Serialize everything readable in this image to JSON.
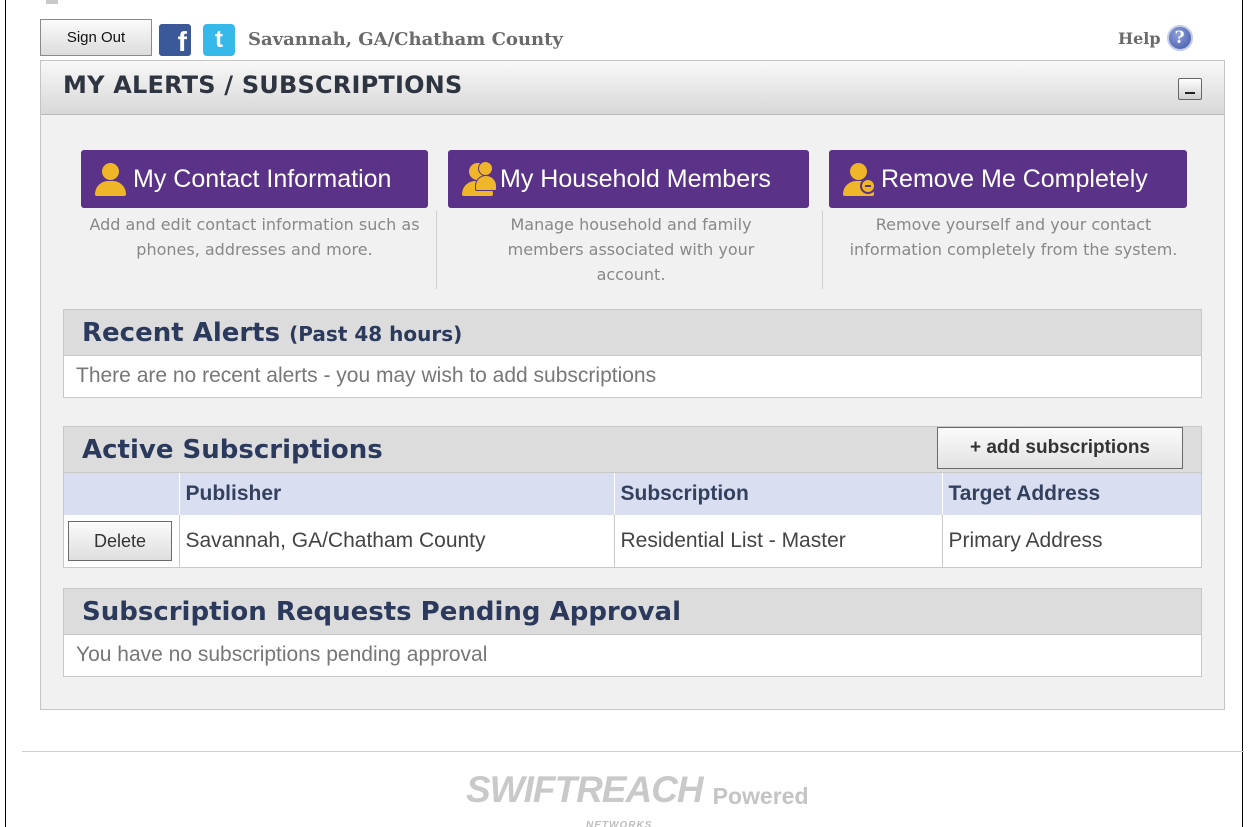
{
  "topbar": {
    "signout_label": "Sign Out",
    "facebook_glyph": "f",
    "twitter_glyph": "t",
    "agency": "Savannah, GA/Chatham County",
    "help_label": "Help",
    "help_glyph": "?"
  },
  "panel": {
    "title": "MY ALERTS / SUBSCRIPTIONS"
  },
  "actions": [
    {
      "label": "My Contact Information",
      "icon": "person-icon",
      "description": "Add and edit contact information such as phones, addresses and more."
    },
    {
      "label": "My Household Members",
      "icon": "household-icon",
      "description": "Manage household and family members associated with your account."
    },
    {
      "label": "Remove Me Completely",
      "icon": "remove-person-icon",
      "description": "Remove yourself and your contact information completely from the system."
    }
  ],
  "recent_alerts": {
    "title": "Recent Alerts",
    "subtitle": "(Past 48 hours)",
    "message": "There are no recent alerts - you may wish to add subscriptions"
  },
  "active_subscriptions": {
    "title": "Active Subscriptions",
    "add_label": "+ add subscriptions",
    "columns": [
      "",
      "Publisher",
      "Subscription",
      "Target Address"
    ],
    "rows": [
      {
        "action": "Delete",
        "publisher": "Savannah, GA/Chatham County",
        "subscription": "Residential List - Master",
        "target": "Primary Address"
      }
    ]
  },
  "pending": {
    "title": "Subscription Requests Pending Approval",
    "message": "You have no subscriptions pending approval"
  },
  "footer": {
    "brand": "SWIFTREACH",
    "brand_sub": "NETWORKS",
    "powered": "Powered"
  },
  "colors": {
    "action_purple": "#5a3287",
    "icon_gold": "#f0b629",
    "section_title": "#2b3a5c"
  }
}
